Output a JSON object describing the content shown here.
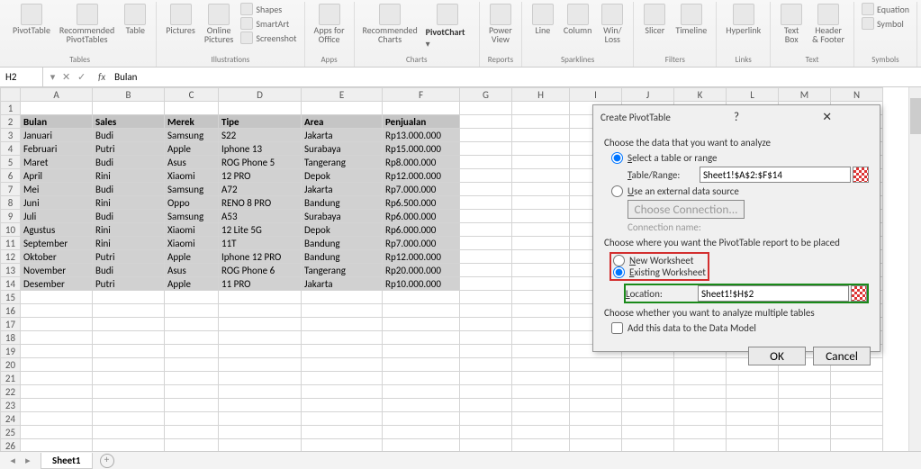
{
  "ribbon": {
    "groups": [
      {
        "label": "Tables",
        "big": [
          {
            "t": "PivotTable"
          },
          {
            "t": "Recommended\nPivotTables"
          },
          {
            "t": "Table"
          }
        ]
      },
      {
        "label": "Illustrations",
        "big": [
          {
            "t": "Pictures"
          },
          {
            "t": "Online\nPictures"
          }
        ],
        "small": [
          "Shapes",
          "SmartArt",
          "Screenshot"
        ]
      },
      {
        "label": "Apps",
        "big": [
          {
            "t": "Apps for\nOffice"
          }
        ]
      },
      {
        "label": "Charts",
        "big": [
          {
            "t": "Recommended\nCharts"
          }
        ],
        "pivot": "PivotChart"
      },
      {
        "label": "Reports",
        "big": [
          {
            "t": "Power\nView"
          }
        ]
      },
      {
        "label": "Sparklines",
        "big": [
          {
            "t": "Line"
          },
          {
            "t": "Column"
          },
          {
            "t": "Win/\nLoss"
          }
        ]
      },
      {
        "label": "Filters",
        "big": [
          {
            "t": "Slicer"
          },
          {
            "t": "Timeline"
          }
        ]
      },
      {
        "label": "Links",
        "big": [
          {
            "t": "Hyperlink"
          }
        ]
      },
      {
        "label": "Text",
        "big": [
          {
            "t": "Text\nBox"
          },
          {
            "t": "Header\n& Footer"
          }
        ]
      },
      {
        "label": "Symbols",
        "small": [
          "Equation",
          "Symbol"
        ]
      }
    ]
  },
  "formula": {
    "cell": "H2",
    "fx": "fx",
    "value": "Bulan"
  },
  "columns": [
    "A",
    "B",
    "C",
    "D",
    "E",
    "F",
    "G",
    "H",
    "I",
    "J",
    "K",
    "L",
    "M",
    "N"
  ],
  "headers": [
    "Bulan",
    "Sales",
    "Merek",
    "Tipe",
    "Area",
    "Penjualan"
  ],
  "rows": [
    [
      "Januari",
      "Budi",
      "Samsung",
      "S22",
      "Jakarta",
      "Rp13.000.000"
    ],
    [
      "Februari",
      "Putri",
      "Apple",
      "Iphone 13",
      "Surabaya",
      "Rp15.000.000"
    ],
    [
      "Maret",
      "Budi",
      "Asus",
      "ROG Phone 5",
      "Tangerang",
      "Rp8.000.000"
    ],
    [
      "April",
      "Rini",
      "Xiaomi",
      "12 PRO",
      "Depok",
      "Rp12.000.000"
    ],
    [
      "Mei",
      "Budi",
      "Samsung",
      "A72",
      "Jakarta",
      "Rp7.000.000"
    ],
    [
      "Juni",
      "Rini",
      "Oppo",
      "RENO 8 PRO",
      "Bandung",
      "Rp6.500.000"
    ],
    [
      "Juli",
      "Budi",
      "Samsung",
      "A53",
      "Surabaya",
      "Rp6.000.000"
    ],
    [
      "Agustus",
      "Rini",
      "Xiaomi",
      "12 Lite 5G",
      "Depok",
      "Rp6.000.000"
    ],
    [
      "September",
      "Rini",
      "Xiaomi",
      "11T",
      "Bandung",
      "Rp7.000.000"
    ],
    [
      "Oktober",
      "Putri",
      "Apple",
      "Iphone 12 PRO",
      "Bandung",
      "Rp12.000.000"
    ],
    [
      "November",
      "Budi",
      "Asus",
      "ROG Phone 6",
      "Tangerang",
      "Rp20.000.000"
    ],
    [
      "Desember",
      "Putri",
      "Apple",
      "11 PRO",
      "Jakarta",
      "Rp10.000.000"
    ]
  ],
  "dialog": {
    "title": "Create PivotTable",
    "chooseData": "Choose the data that you want to analyze",
    "selectRange": "Select a table or range",
    "tableRangeLabel": "Table/Range:",
    "tableRange": "Sheet1!$A$2:$F$14",
    "externalSrc": "Use an external data source",
    "chooseConn": "Choose Connection...",
    "connName": "Connection name:",
    "choosePlace": "Choose where you want the PivotTable report to be placed",
    "newWs": "New Worksheet",
    "existWs": "Existing Worksheet",
    "locationLabel": "Location:",
    "location": "Sheet1!$H$2",
    "multi": "Choose whether you want to analyze multiple tables",
    "addModel": "Add this data to the Data Model",
    "ok": "OK",
    "cancel": "Cancel"
  },
  "tabs": {
    "sheet": "Sheet1"
  }
}
